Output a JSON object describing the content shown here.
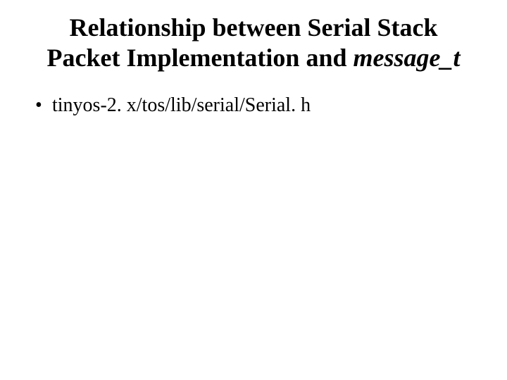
{
  "title": {
    "line1": "Relationship between Serial Stack",
    "line2_prefix": "Packet Implementation and ",
    "line2_italic": "message_t"
  },
  "bullets": [
    "tinyos-2. x/tos/lib/serial/Serial. h"
  ]
}
